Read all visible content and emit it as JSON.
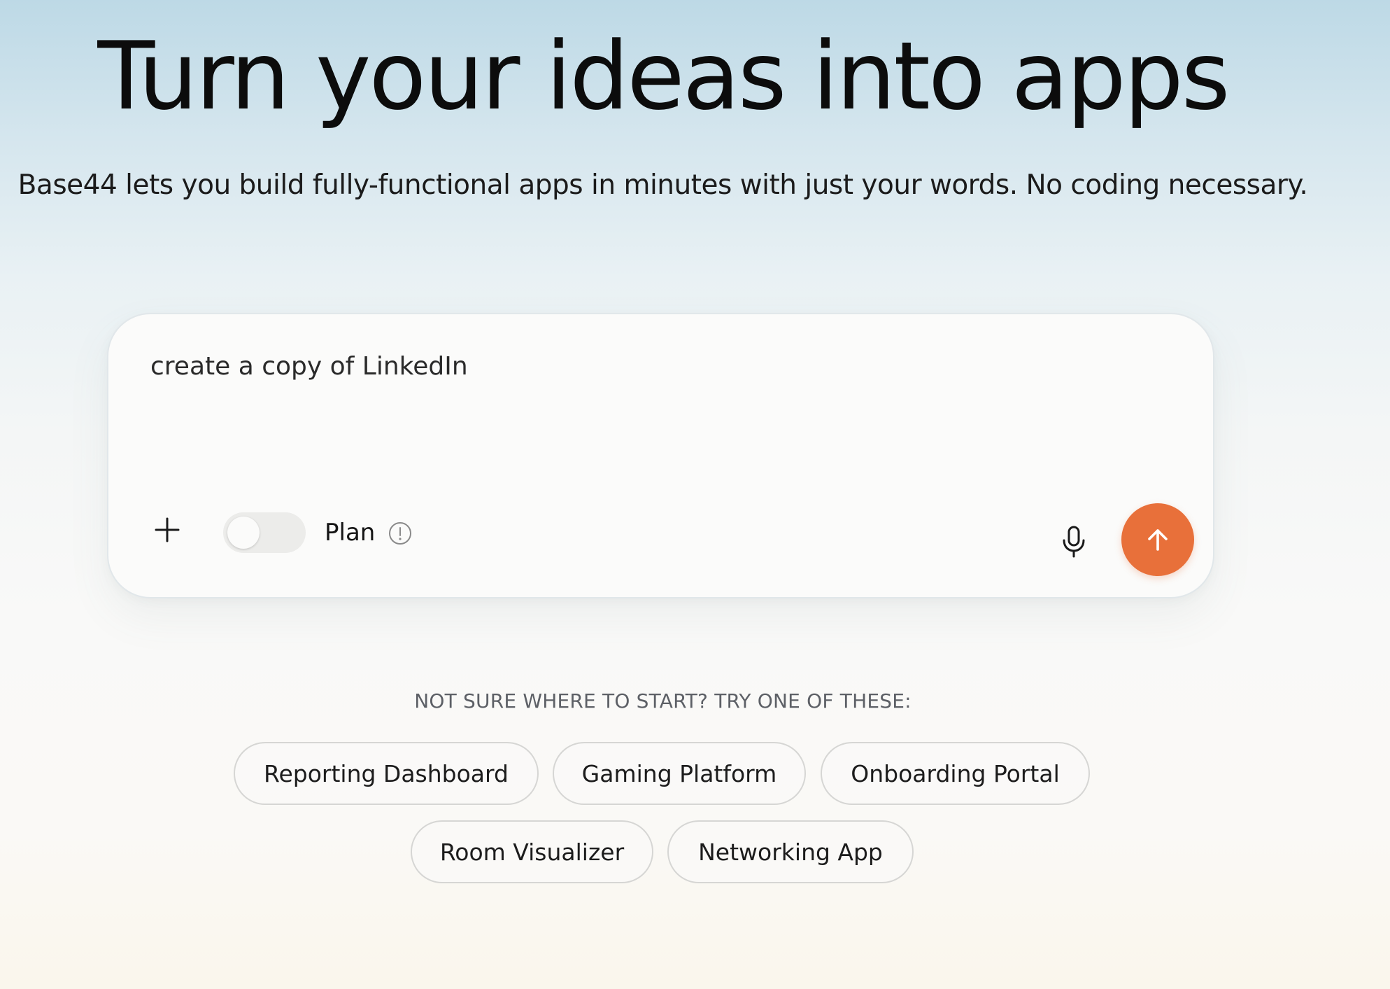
{
  "hero": {
    "title": "Turn your ideas into apps",
    "subtitle": "Base44 lets you build fully-functional apps in minutes with just your words. No coding necessary."
  },
  "prompt": {
    "value": "create a copy of LinkedIn",
    "plan_label": "Plan",
    "plan_enabled": false,
    "icons": {
      "add": "plus-icon",
      "info": "info-icon",
      "mic": "microphone-icon",
      "send": "arrow-up-icon"
    },
    "send_color": "#e8703a"
  },
  "suggestions": {
    "heading": "NOT SURE WHERE TO START? TRY ONE OF THESE:",
    "items": [
      "Reporting Dashboard",
      "Gaming Platform",
      "Onboarding Portal",
      "Room Visualizer",
      "Networking App"
    ]
  }
}
